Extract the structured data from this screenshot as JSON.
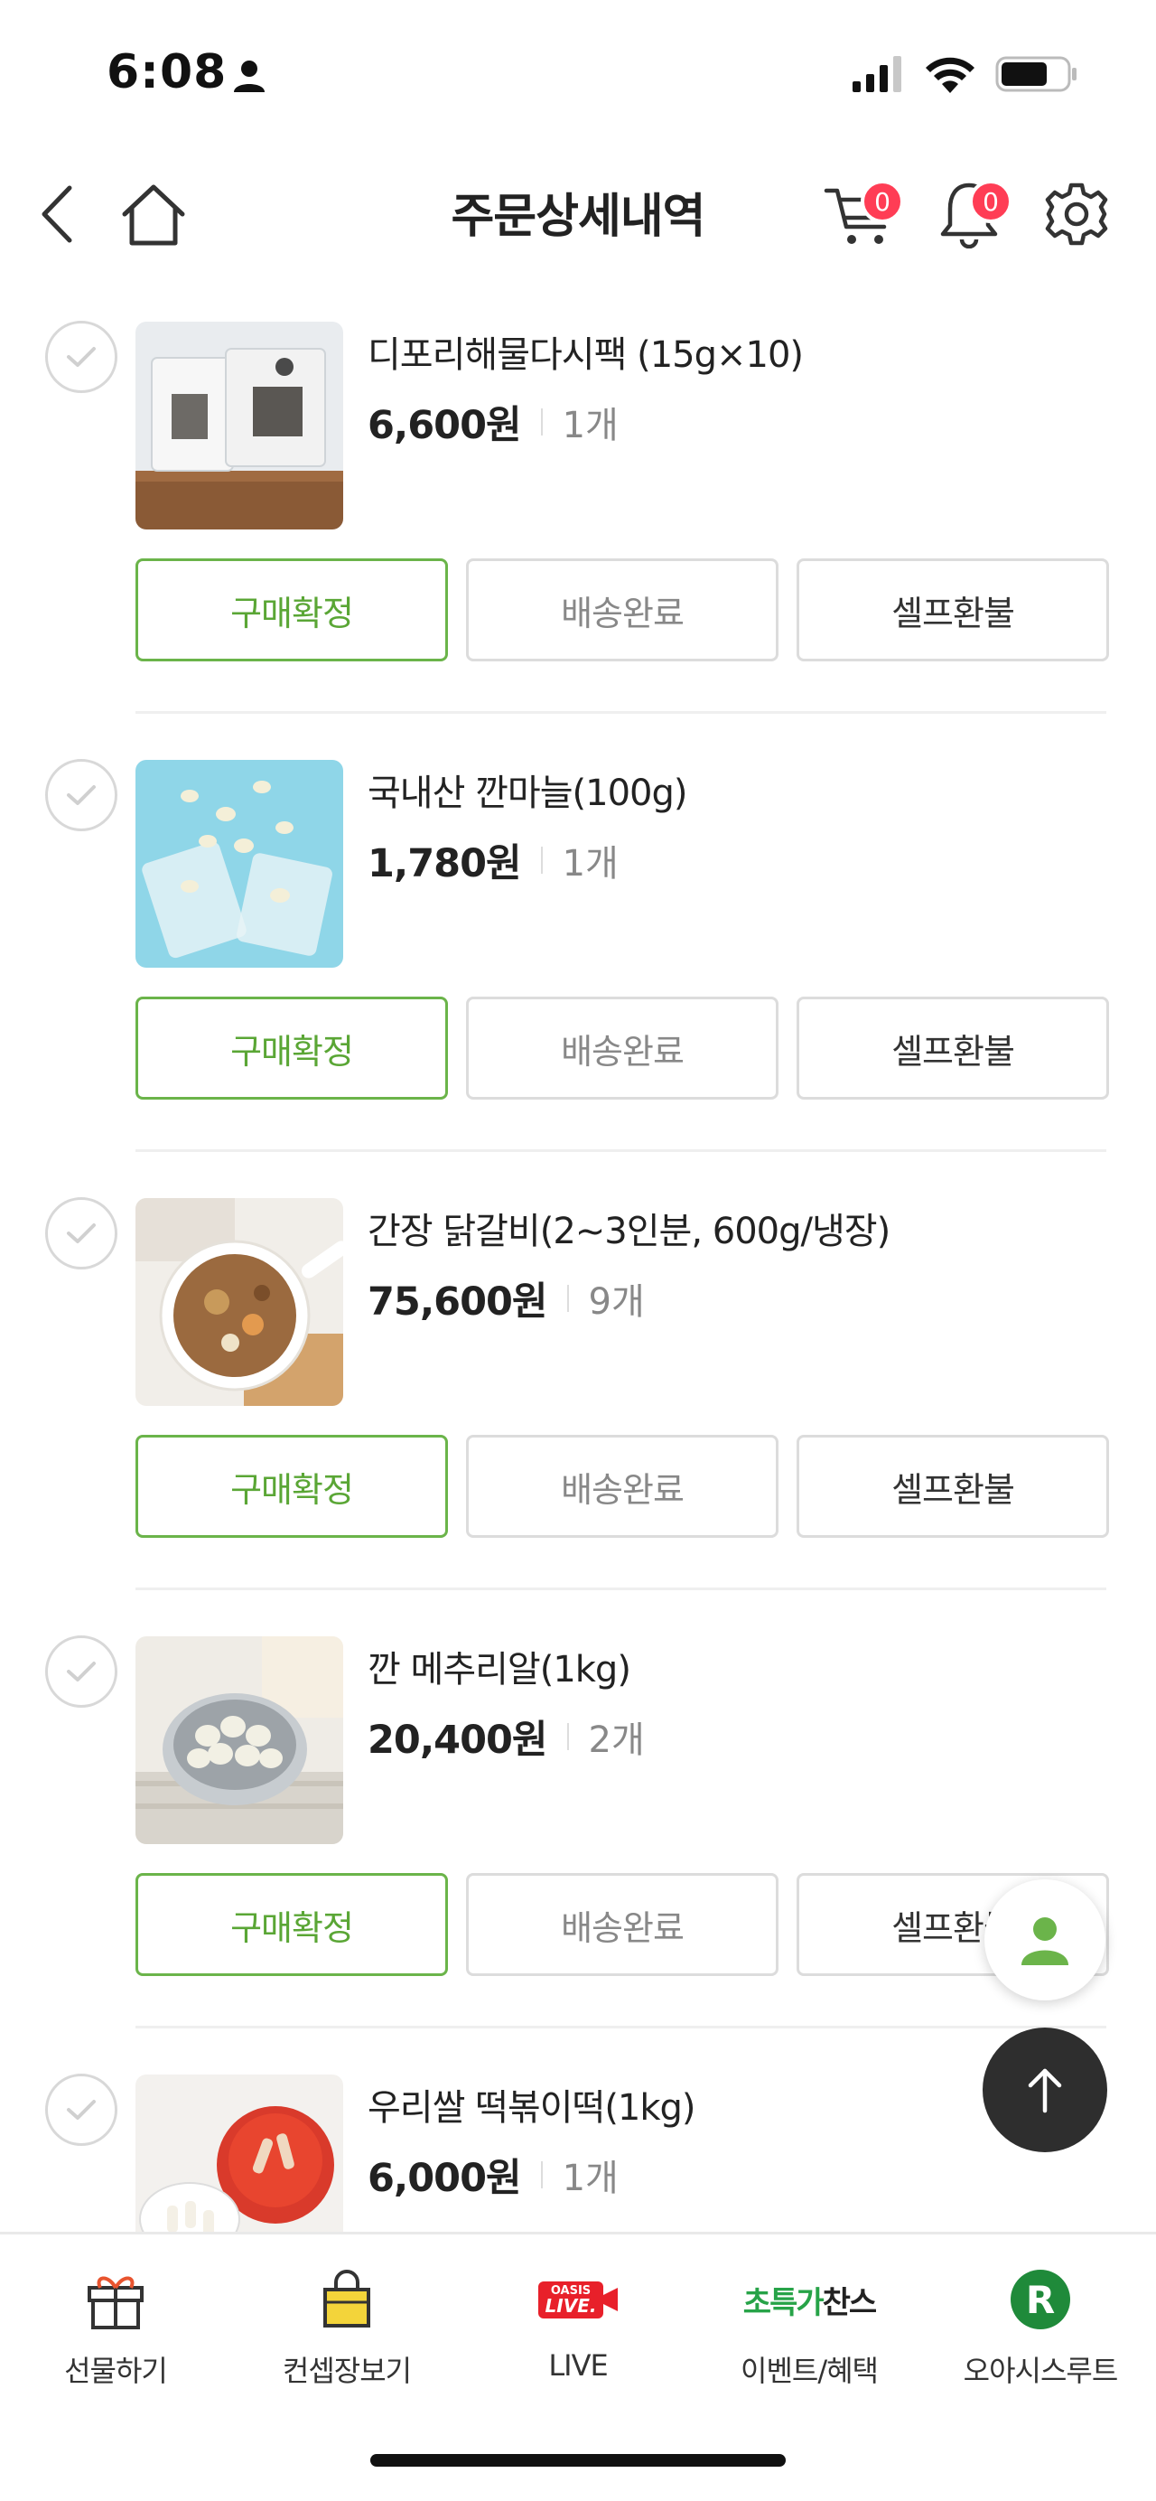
{
  "status_bar": {
    "time": "6:08"
  },
  "header": {
    "title": "주문상세내역",
    "cart_count": "0",
    "notification_count": "0"
  },
  "items": [
    {
      "name": "디포리해물다시팩 (15g×10)",
      "price": "6,600원",
      "qty": "1개",
      "image": "dashi-pack-photo",
      "btn_confirm": "구매확정",
      "btn_delivered": "배송완료",
      "btn_refund": "셀프환불"
    },
    {
      "name": "국내산 깐마늘(100g)",
      "price": "1,780원",
      "qty": "1개",
      "image": "garlic-photo",
      "btn_confirm": "구매확정",
      "btn_delivered": "배송완료",
      "btn_refund": "셀프환불"
    },
    {
      "name": "간장 닭갈비(2~3인분, 600g/냉장)",
      "price": "75,600원",
      "qty": "9개",
      "image": "dakgalbi-photo",
      "btn_confirm": "구매확정",
      "btn_delivered": "배송완료",
      "btn_refund": "셀프환불"
    },
    {
      "name": "깐 메추리알(1kg)",
      "price": "20,400원",
      "qty": "2개",
      "image": "quail-egg-photo",
      "btn_confirm": "구매확정",
      "btn_delivered": "배송완료",
      "btn_refund": "셀프환불"
    },
    {
      "name": "우리쌀 떡볶이떡(1kg)",
      "price": "6,000원",
      "qty": "1개",
      "image": "tteok-photo"
    }
  ],
  "bottom_nav": {
    "gift": "선물하기",
    "concept": "컨셉장보기",
    "live": "LIVE",
    "live_logo_top": "OASIS",
    "live_logo_bottom": "LIVE.",
    "event": "이벤트/혜택",
    "event_logo_green": "초특가",
    "event_logo_dark": "찬스",
    "route": "오아시스루트",
    "route_logo": "R"
  },
  "colors": {
    "accent_green": "#5aa635",
    "badge_red": "#ff3d55",
    "live_red": "#e8202a",
    "route_green": "#1f8a3a"
  }
}
